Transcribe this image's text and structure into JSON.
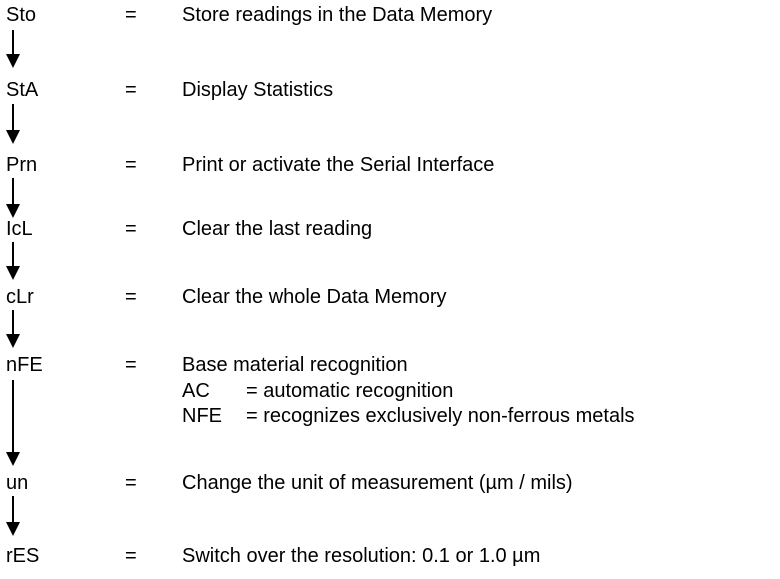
{
  "items": [
    {
      "code": "Sto",
      "eq": "=",
      "desc": "Store readings in the Data Memory"
    },
    {
      "code": "StA",
      "eq": "=",
      "desc": "Display Statistics"
    },
    {
      "code": "Prn",
      "eq": "=",
      "desc": "Print or activate the Serial Interface"
    },
    {
      "code": "IcL",
      "eq": "=",
      "desc": "Clear the last reading"
    },
    {
      "code": "cLr",
      "eq": "=",
      "desc": "Clear the whole Data Memory"
    },
    {
      "code": "nFE",
      "eq": "=",
      "desc": "Base material recognition",
      "sub": [
        {
          "key": "AC",
          "val": "= automatic recognition"
        },
        {
          "key": "NFE",
          "val": "= recognizes exclusively non-ferrous metals"
        }
      ]
    },
    {
      "code": "un",
      "eq": "=",
      "desc": "Change the unit of measurement (µm / mils)"
    },
    {
      "code": "rES",
      "eq": "=",
      "desc": "Switch over the resolution: 0.1 or 1.0 µm"
    }
  ]
}
